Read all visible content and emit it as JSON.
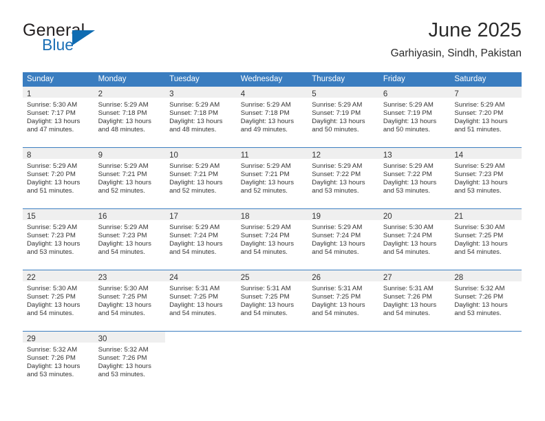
{
  "brand": {
    "name_part1": "General",
    "name_part2": "Blue",
    "flag_icon": "triangle-flag-icon",
    "accent_color": "#0f6cb2"
  },
  "header": {
    "month_title": "June 2025",
    "location": "Garhiyasin, Sindh, Pakistan"
  },
  "theme": {
    "header_bg": "#3a7dc0",
    "header_text": "#ffffff",
    "daynum_band_bg": "#efefef",
    "row_divider": "#3a7dc0",
    "body_text": "#333333"
  },
  "calendar": {
    "weekday_headers": [
      "Sunday",
      "Monday",
      "Tuesday",
      "Wednesday",
      "Thursday",
      "Friday",
      "Saturday"
    ],
    "weeks": [
      [
        {
          "day": "1",
          "lines": [
            "Sunrise: 5:30 AM",
            "Sunset: 7:17 PM",
            "Daylight: 13 hours",
            "and 47 minutes."
          ]
        },
        {
          "day": "2",
          "lines": [
            "Sunrise: 5:29 AM",
            "Sunset: 7:18 PM",
            "Daylight: 13 hours",
            "and 48 minutes."
          ]
        },
        {
          "day": "3",
          "lines": [
            "Sunrise: 5:29 AM",
            "Sunset: 7:18 PM",
            "Daylight: 13 hours",
            "and 48 minutes."
          ]
        },
        {
          "day": "4",
          "lines": [
            "Sunrise: 5:29 AM",
            "Sunset: 7:18 PM",
            "Daylight: 13 hours",
            "and 49 minutes."
          ]
        },
        {
          "day": "5",
          "lines": [
            "Sunrise: 5:29 AM",
            "Sunset: 7:19 PM",
            "Daylight: 13 hours",
            "and 50 minutes."
          ]
        },
        {
          "day": "6",
          "lines": [
            "Sunrise: 5:29 AM",
            "Sunset: 7:19 PM",
            "Daylight: 13 hours",
            "and 50 minutes."
          ]
        },
        {
          "day": "7",
          "lines": [
            "Sunrise: 5:29 AM",
            "Sunset: 7:20 PM",
            "Daylight: 13 hours",
            "and 51 minutes."
          ]
        }
      ],
      [
        {
          "day": "8",
          "lines": [
            "Sunrise: 5:29 AM",
            "Sunset: 7:20 PM",
            "Daylight: 13 hours",
            "and 51 minutes."
          ]
        },
        {
          "day": "9",
          "lines": [
            "Sunrise: 5:29 AM",
            "Sunset: 7:21 PM",
            "Daylight: 13 hours",
            "and 52 minutes."
          ]
        },
        {
          "day": "10",
          "lines": [
            "Sunrise: 5:29 AM",
            "Sunset: 7:21 PM",
            "Daylight: 13 hours",
            "and 52 minutes."
          ]
        },
        {
          "day": "11",
          "lines": [
            "Sunrise: 5:29 AM",
            "Sunset: 7:21 PM",
            "Daylight: 13 hours",
            "and 52 minutes."
          ]
        },
        {
          "day": "12",
          "lines": [
            "Sunrise: 5:29 AM",
            "Sunset: 7:22 PM",
            "Daylight: 13 hours",
            "and 53 minutes."
          ]
        },
        {
          "day": "13",
          "lines": [
            "Sunrise: 5:29 AM",
            "Sunset: 7:22 PM",
            "Daylight: 13 hours",
            "and 53 minutes."
          ]
        },
        {
          "day": "14",
          "lines": [
            "Sunrise: 5:29 AM",
            "Sunset: 7:23 PM",
            "Daylight: 13 hours",
            "and 53 minutes."
          ]
        }
      ],
      [
        {
          "day": "15",
          "lines": [
            "Sunrise: 5:29 AM",
            "Sunset: 7:23 PM",
            "Daylight: 13 hours",
            "and 53 minutes."
          ]
        },
        {
          "day": "16",
          "lines": [
            "Sunrise: 5:29 AM",
            "Sunset: 7:23 PM",
            "Daylight: 13 hours",
            "and 54 minutes."
          ]
        },
        {
          "day": "17",
          "lines": [
            "Sunrise: 5:29 AM",
            "Sunset: 7:24 PM",
            "Daylight: 13 hours",
            "and 54 minutes."
          ]
        },
        {
          "day": "18",
          "lines": [
            "Sunrise: 5:29 AM",
            "Sunset: 7:24 PM",
            "Daylight: 13 hours",
            "and 54 minutes."
          ]
        },
        {
          "day": "19",
          "lines": [
            "Sunrise: 5:29 AM",
            "Sunset: 7:24 PM",
            "Daylight: 13 hours",
            "and 54 minutes."
          ]
        },
        {
          "day": "20",
          "lines": [
            "Sunrise: 5:30 AM",
            "Sunset: 7:24 PM",
            "Daylight: 13 hours",
            "and 54 minutes."
          ]
        },
        {
          "day": "21",
          "lines": [
            "Sunrise: 5:30 AM",
            "Sunset: 7:25 PM",
            "Daylight: 13 hours",
            "and 54 minutes."
          ]
        }
      ],
      [
        {
          "day": "22",
          "lines": [
            "Sunrise: 5:30 AM",
            "Sunset: 7:25 PM",
            "Daylight: 13 hours",
            "and 54 minutes."
          ]
        },
        {
          "day": "23",
          "lines": [
            "Sunrise: 5:30 AM",
            "Sunset: 7:25 PM",
            "Daylight: 13 hours",
            "and 54 minutes."
          ]
        },
        {
          "day": "24",
          "lines": [
            "Sunrise: 5:31 AM",
            "Sunset: 7:25 PM",
            "Daylight: 13 hours",
            "and 54 minutes."
          ]
        },
        {
          "day": "25",
          "lines": [
            "Sunrise: 5:31 AM",
            "Sunset: 7:25 PM",
            "Daylight: 13 hours",
            "and 54 minutes."
          ]
        },
        {
          "day": "26",
          "lines": [
            "Sunrise: 5:31 AM",
            "Sunset: 7:25 PM",
            "Daylight: 13 hours",
            "and 54 minutes."
          ]
        },
        {
          "day": "27",
          "lines": [
            "Sunrise: 5:31 AM",
            "Sunset: 7:26 PM",
            "Daylight: 13 hours",
            "and 54 minutes."
          ]
        },
        {
          "day": "28",
          "lines": [
            "Sunrise: 5:32 AM",
            "Sunset: 7:26 PM",
            "Daylight: 13 hours",
            "and 53 minutes."
          ]
        }
      ],
      [
        {
          "day": "29",
          "lines": [
            "Sunrise: 5:32 AM",
            "Sunset: 7:26 PM",
            "Daylight: 13 hours",
            "and 53 minutes."
          ]
        },
        {
          "day": "30",
          "lines": [
            "Sunrise: 5:32 AM",
            "Sunset: 7:26 PM",
            "Daylight: 13 hours",
            "and 53 minutes."
          ]
        },
        {
          "day": "",
          "lines": []
        },
        {
          "day": "",
          "lines": []
        },
        {
          "day": "",
          "lines": []
        },
        {
          "day": "",
          "lines": []
        },
        {
          "day": "",
          "lines": []
        }
      ]
    ]
  }
}
